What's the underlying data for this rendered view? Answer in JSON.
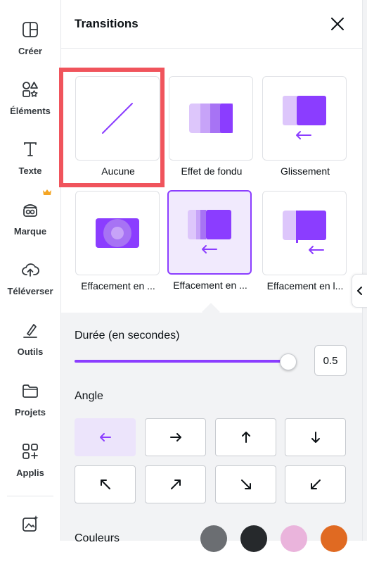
{
  "sidebar": {
    "items": [
      {
        "label": "Créer",
        "icon": "create-icon"
      },
      {
        "label": "Éléments",
        "icon": "elements-icon"
      },
      {
        "label": "Texte",
        "icon": "text-icon"
      },
      {
        "label": "Marque",
        "icon": "brand-icon"
      },
      {
        "label": "Téléverser",
        "icon": "upload-icon"
      },
      {
        "label": "Outils",
        "icon": "tools-icon"
      },
      {
        "label": "Projets",
        "icon": "folder-icon"
      },
      {
        "label": "Applis",
        "icon": "apps-icon"
      }
    ],
    "bottom_icon": "magic-media-icon"
  },
  "panel": {
    "title": "Transitions",
    "transitions": [
      {
        "label": "Aucune",
        "icon": "none-transition-icon"
      },
      {
        "label": "Effet de fondu",
        "icon": "fade-transition-icon"
      },
      {
        "label": "Glissement",
        "icon": "slide-transition-icon"
      },
      {
        "label": "Effacement en ...",
        "icon": "circle-wipe-icon"
      },
      {
        "label": "Effacement en ...",
        "icon": "wipe-transition-icon",
        "selected": true
      },
      {
        "label": "Effacement en l...",
        "icon": "line-wipe-icon"
      }
    ],
    "duration": {
      "label": "Durée (en secondes)",
      "value": "0.5",
      "slider_fraction": 0.97
    },
    "angle": {
      "label": "Angle",
      "directions": [
        "←",
        "→",
        "↑",
        "↓",
        "↖",
        "↗",
        "↘",
        "↙"
      ],
      "active_index": 0
    },
    "colors": {
      "label": "Couleurs",
      "swatches": [
        "#6b6e72",
        "#26292c",
        "#eab4dc",
        "#e06a22"
      ]
    }
  },
  "accent": "#8b3dff",
  "highlight_color": "#f0545c"
}
